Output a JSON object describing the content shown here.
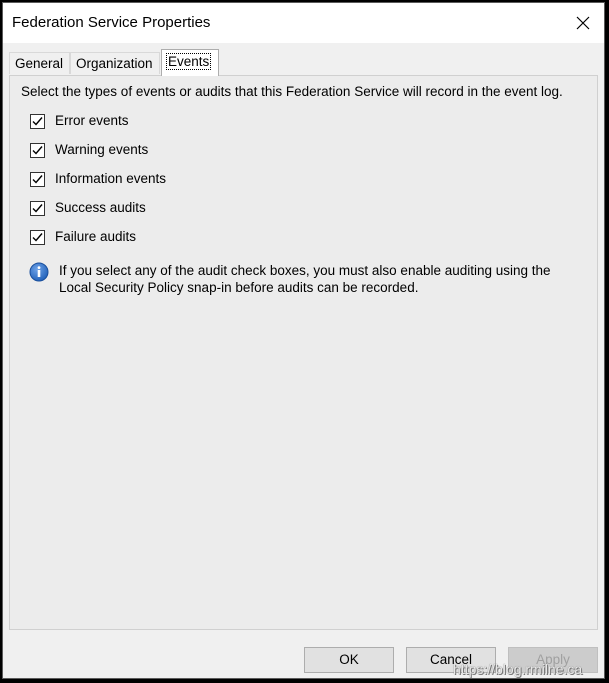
{
  "window": {
    "title": "Federation Service Properties"
  },
  "tabs": [
    {
      "label": "General",
      "active": false
    },
    {
      "label": "Organization",
      "active": false
    },
    {
      "label": "Events",
      "active": true
    }
  ],
  "events_panel": {
    "intro": "Select the types of events or audits that this Federation Service will record in the event log.",
    "checkboxes": [
      {
        "label": "Error events",
        "checked": true
      },
      {
        "label": "Warning events",
        "checked": true
      },
      {
        "label": "Information events",
        "checked": true
      },
      {
        "label": "Success audits",
        "checked": true
      },
      {
        "label": "Failure audits",
        "checked": true
      }
    ],
    "info_icon": "info-icon",
    "info_text": "If you select any of the audit check boxes, you must also enable auditing using the Local Security Policy snap-in before audits can be recorded."
  },
  "buttons": {
    "ok": "OK",
    "cancel": "Cancel",
    "apply": "Apply",
    "apply_enabled": false
  },
  "watermark": "https://blog.rmilne.ca",
  "colors": {
    "dialog_bg": "#f0f0f0",
    "panel_bg": "#ececec",
    "info_icon_blue": "#1f5fb8"
  }
}
